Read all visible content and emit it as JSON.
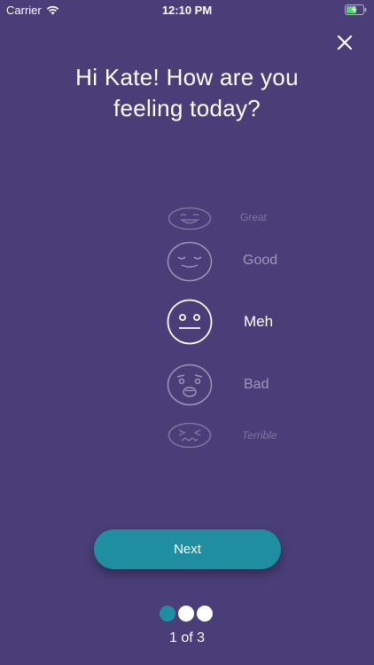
{
  "status_bar": {
    "carrier": "Carrier",
    "time": "12:10 PM",
    "battery_level": 0.6
  },
  "header": {
    "title_line1": "Hi Kate! How are you",
    "title_line2": "feeling today?"
  },
  "moods": [
    {
      "label": "Great",
      "icon": "smile-face-icon"
    },
    {
      "label": "Good",
      "icon": "content-face-icon"
    },
    {
      "label": "Meh",
      "icon": "neutral-face-icon",
      "selected": true
    },
    {
      "label": "Bad",
      "icon": "worried-face-icon"
    },
    {
      "label": "Terrible",
      "icon": "distressed-face-icon"
    }
  ],
  "actions": {
    "next_label": "Next"
  },
  "pager": {
    "text": "1 of 3",
    "current_page": 1,
    "total_pages": 3
  },
  "colors": {
    "background": "#4a3e78",
    "accent": "#1e8ea0"
  }
}
